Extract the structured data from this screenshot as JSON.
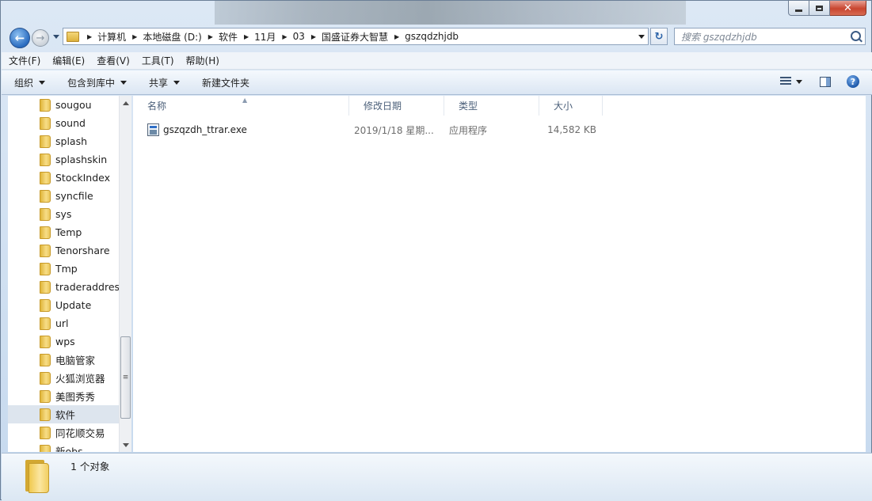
{
  "window": {
    "caption": {
      "minimize": "",
      "maximize": "",
      "close": "✕"
    }
  },
  "address_bar": {
    "crumbs": [
      "计算机",
      "本地磁盘 (D:)",
      "软件",
      "11月",
      "03",
      "国盛证券大智慧",
      "gszqdzhjdb"
    ],
    "search_placeholder": "搜索 gszqdzhjdb"
  },
  "menu": [
    "文件(F)",
    "编辑(E)",
    "查看(V)",
    "工具(T)",
    "帮助(H)"
  ],
  "toolbar": {
    "organize": "组织",
    "include_in_library": "包含到库中",
    "share": "共享",
    "new_folder": "新建文件夹"
  },
  "nav_tree": {
    "items": [
      {
        "label": "sougou"
      },
      {
        "label": "sound"
      },
      {
        "label": "splash"
      },
      {
        "label": "splashskin"
      },
      {
        "label": "StockIndex"
      },
      {
        "label": "syncfile"
      },
      {
        "label": "sys"
      },
      {
        "label": "Temp"
      },
      {
        "label": "Tenorshare"
      },
      {
        "label": "Tmp"
      },
      {
        "label": "traderaddress"
      },
      {
        "label": "Update"
      },
      {
        "label": "url"
      },
      {
        "label": "wps"
      },
      {
        "label": "电脑管家"
      },
      {
        "label": "火狐浏览器"
      },
      {
        "label": "美图秀秀"
      },
      {
        "label": "软件",
        "selected": true
      },
      {
        "label": "同花顺交易"
      },
      {
        "label": "新obs"
      }
    ]
  },
  "columns": {
    "name": "名称",
    "date": "修改日期",
    "type": "类型",
    "size": "大小"
  },
  "files": [
    {
      "name": "gszqzdh_ttrar.exe",
      "date": "2019/1/18 星期...",
      "type": "应用程序",
      "size": "14,582 KB"
    }
  ],
  "details": {
    "count_text": "1 个对象"
  }
}
